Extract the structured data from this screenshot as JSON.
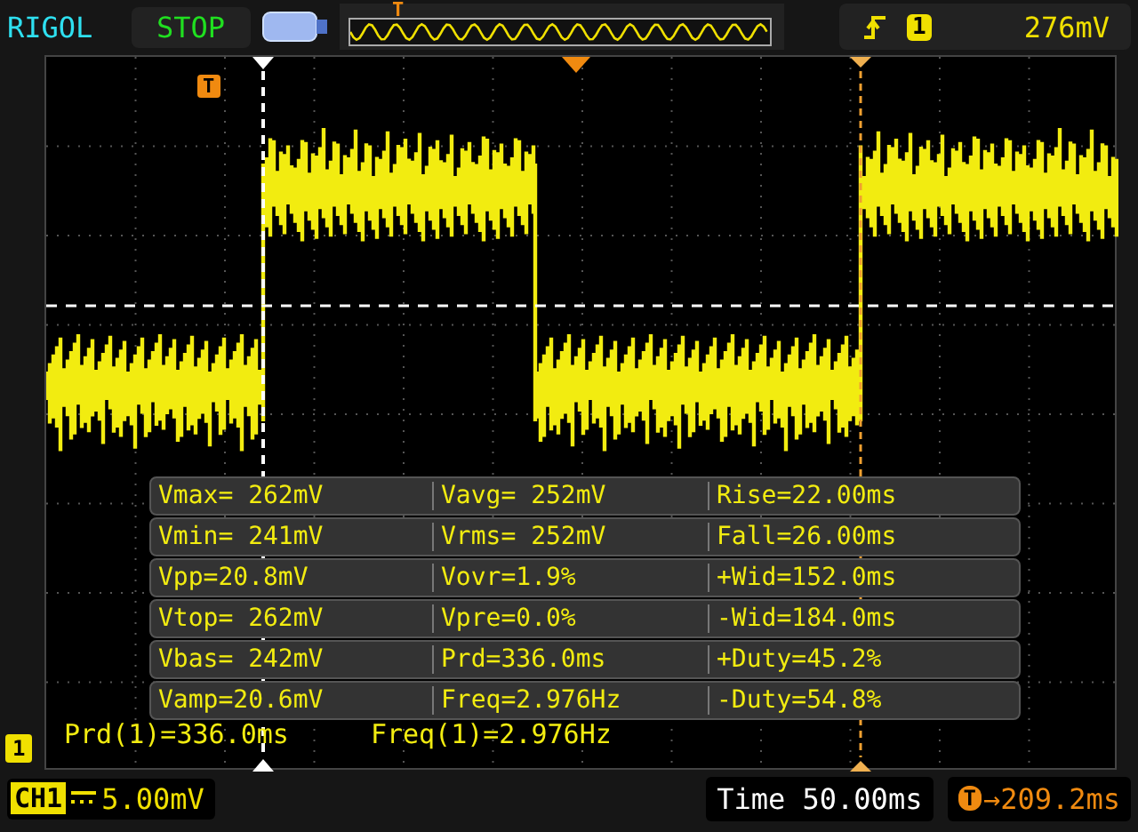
{
  "header": {
    "brand": "RIGOL",
    "run_state": "STOP",
    "overview_trigger": "T",
    "trigger_channel": "1",
    "trigger_level": "276mV"
  },
  "markers": {
    "trigger_tag": "T",
    "channel_tag": "1"
  },
  "measurements": [
    [
      "Vmax= 262mV",
      "Vavg= 252mV",
      "Rise=22.00ms"
    ],
    [
      "Vmin= 241mV",
      "Vrms= 252mV",
      "Fall=26.00ms"
    ],
    [
      "Vpp=20.8mV",
      "Vovr=1.9%",
      "+Wid=152.0ms"
    ],
    [
      "Vtop= 262mV",
      "Vpre=0.0%",
      "-Wid=184.0ms"
    ],
    [
      "Vbas= 242mV",
      "Prd=336.0ms",
      "+Duty=45.2%"
    ],
    [
      "Vamp=20.6mV",
      "Freq=2.976Hz",
      "-Duty=54.8%"
    ]
  ],
  "readouts": [
    "Prd(1)=336.0ms",
    "Freq(1)=2.976Hz"
  ],
  "footer": {
    "channel": "CH1",
    "vertical_scale": "5.00mV",
    "timebase": "Time 50.00ms",
    "trigger_offset_tag": "T",
    "trigger_offset": "→209.2ms"
  }
}
